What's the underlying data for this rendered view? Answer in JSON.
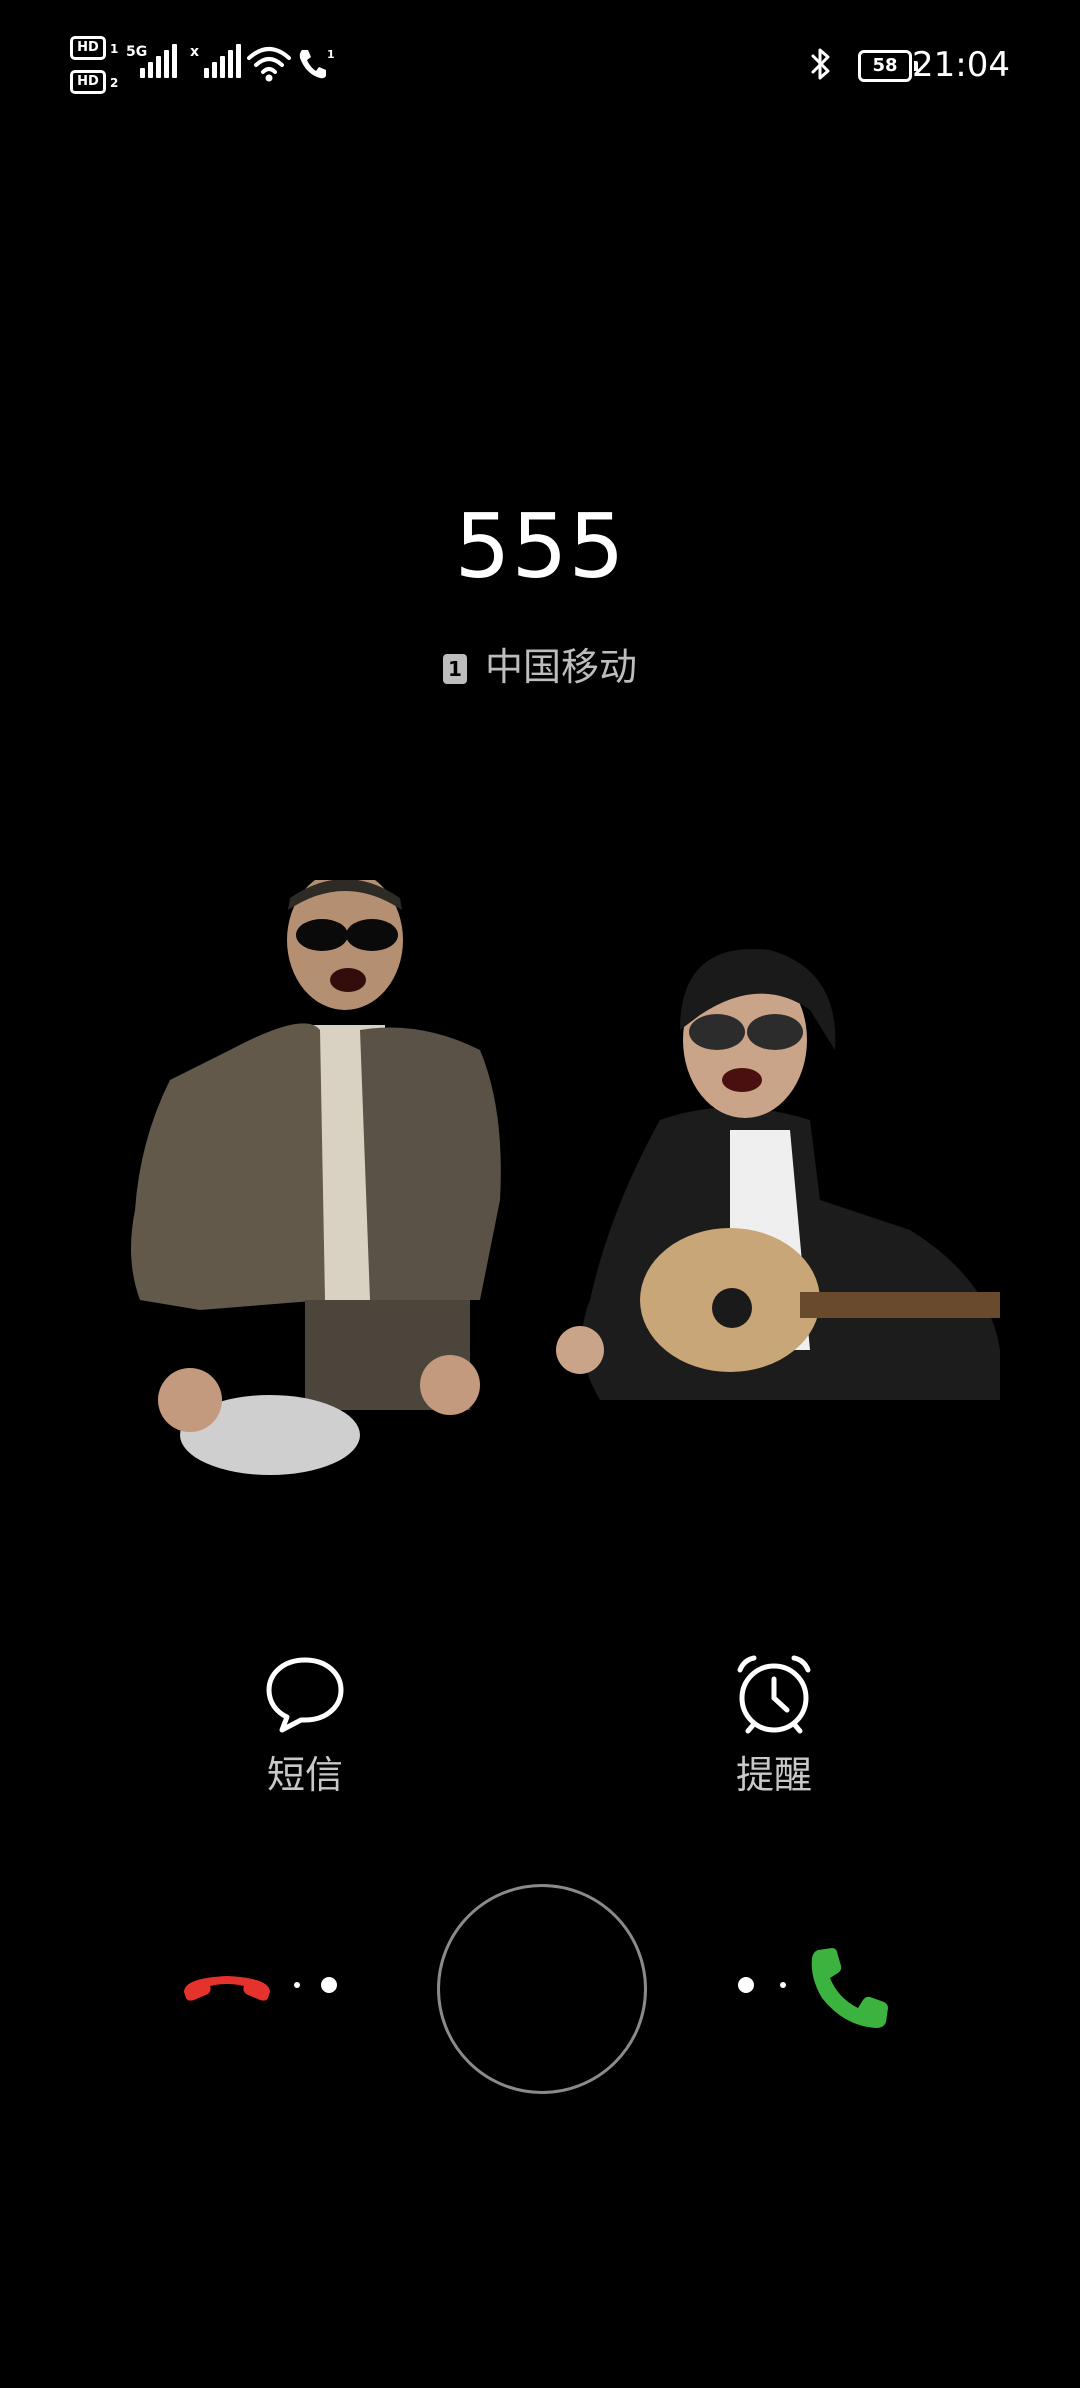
{
  "status_bar": {
    "time": "21:04",
    "battery_level": "58",
    "hd1_label": "HD",
    "hd1_sub": "1",
    "hd2_label": "HD",
    "hd2_sub": "2",
    "sim1_network": "5G",
    "sim2_network": "x",
    "call_sim": "1",
    "icons": [
      "hd-voice-icon",
      "signal-icon",
      "wifi-icon",
      "call-icon",
      "bluetooth-icon",
      "battery-icon"
    ]
  },
  "call": {
    "number": "555",
    "sim_slot": "1",
    "carrier": "中国移动"
  },
  "quick_actions": {
    "message_label": "短信",
    "remind_label": "提醒"
  },
  "controls": {
    "decline_icon": "phone-hangup-icon",
    "answer_icon": "phone-answer-icon",
    "decline_color": "#e5322d",
    "answer_color": "#3db33f"
  }
}
